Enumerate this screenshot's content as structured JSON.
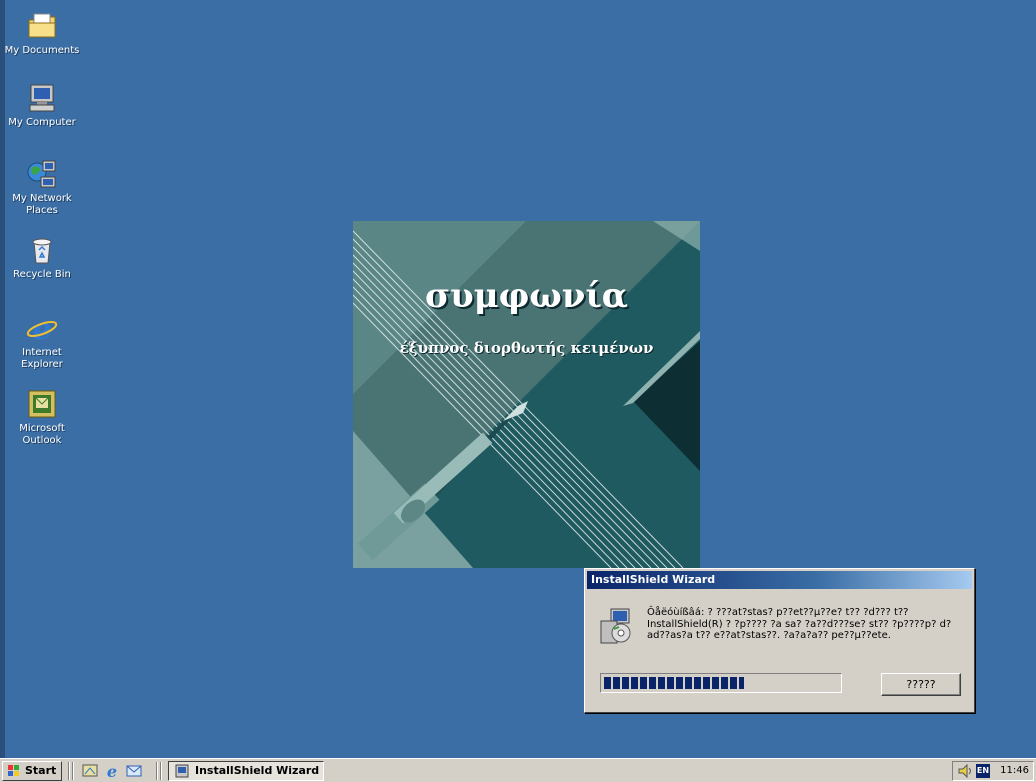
{
  "desktop": {
    "icons": [
      {
        "label": "My Documents"
      },
      {
        "label": "My Computer"
      },
      {
        "label": "My Network Places"
      },
      {
        "label": "Recycle Bin"
      },
      {
        "label": "Internet Explorer"
      },
      {
        "label": "Microsoft Outlook"
      }
    ]
  },
  "splash": {
    "title": "συμφωνία",
    "subtitle": "έξυπνος διορθωτής κειμένων"
  },
  "dialog": {
    "title": "InstallShield Wizard",
    "message": "Ôåëóùíßâá: ? ???at?stas? p??et??µ??e? t?? ?d??? t?? InstallShield(R) ? ?p???? ?a sa? ?a??d???se? st?? ?p????p? d?ad??as?a t?? e??at?stas??. ?a?a?a?? pe??µ??ete.",
    "progress_percent": 60,
    "cancel_label": "?????"
  },
  "taskbar": {
    "start_label": "Start",
    "task_label": "InstallShield Wizard",
    "language": "EN",
    "clock": "11:46"
  }
}
